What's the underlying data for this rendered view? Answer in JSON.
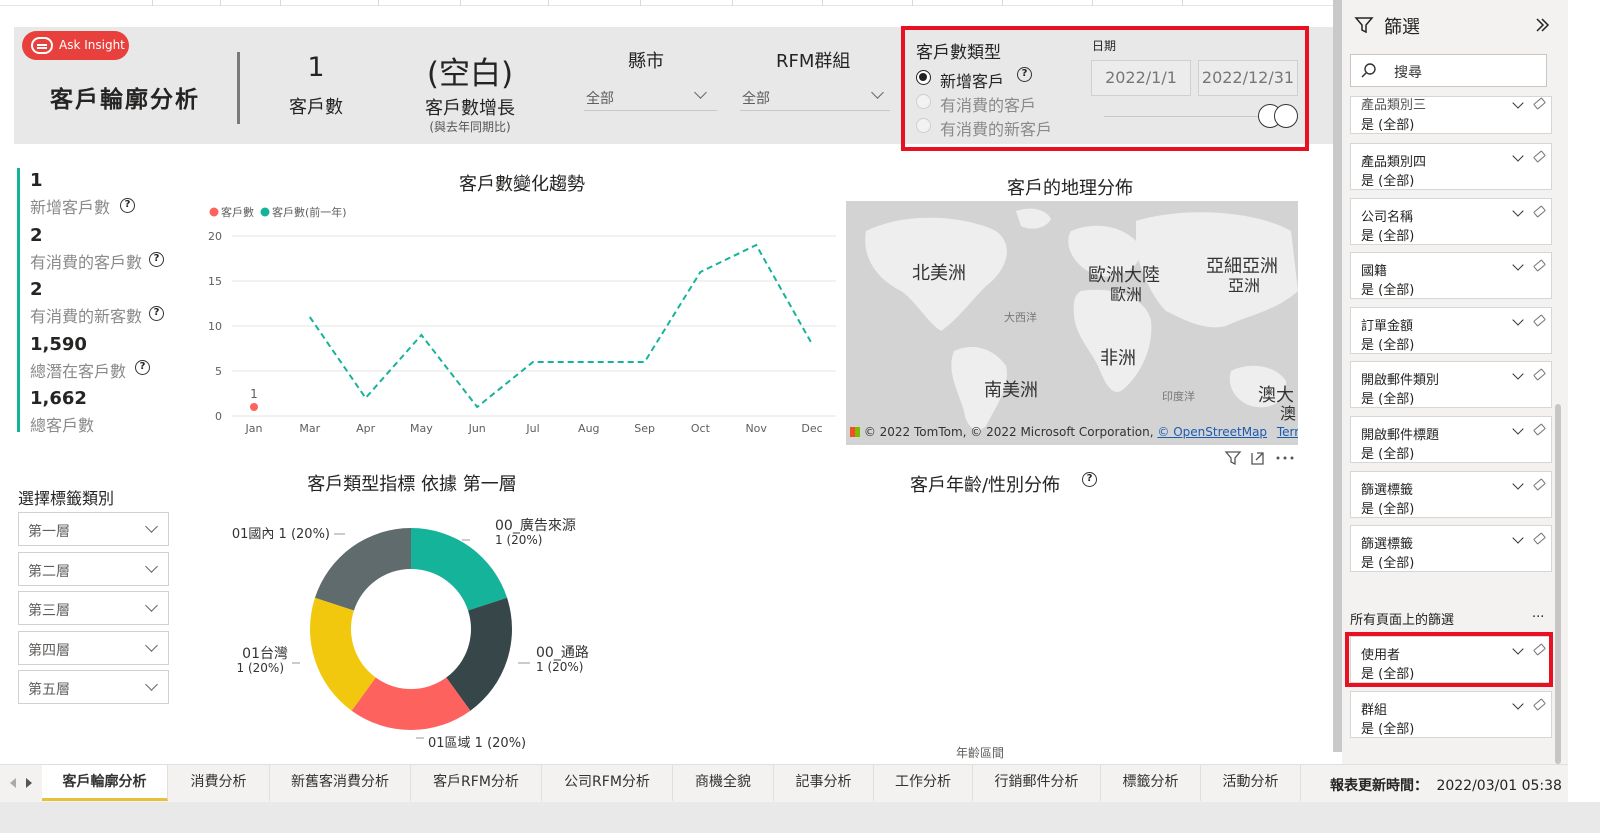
{
  "report": {
    "ask_insight_label": "Ask Insight",
    "title": "客戶輪廓分析"
  },
  "header_kpis": {
    "customer_count_value": "1",
    "customer_count_label": "客戶數",
    "growth_value": "(空白)",
    "growth_label": "客戶數增長",
    "growth_sublabel": "(與去年同期比)"
  },
  "slicers": {
    "county": {
      "title": "縣市",
      "value": "全部"
    },
    "rfm": {
      "title": "RFM群組",
      "value": "全部"
    }
  },
  "customer_type": {
    "title": "客戶數類型",
    "options": [
      {
        "label": "新增客戶",
        "selected": true
      },
      {
        "label": "有消費的客戶",
        "selected": false
      },
      {
        "label": "有消費的新客戶",
        "selected": false
      }
    ],
    "help_icon": "question-circle-icon"
  },
  "date_slicer": {
    "title": "日期",
    "start": "2022/1/1",
    "end": "2022/12/31"
  },
  "kpi_cards": [
    {
      "value": "1",
      "label": "新增客戶數"
    },
    {
      "value": "2",
      "label": "有消費的客戶數"
    },
    {
      "value": "2",
      "label": "有消費的新客數"
    },
    {
      "value": "1,590",
      "label": "總潛在客戶數"
    },
    {
      "value": "1,662",
      "label": "總客戶數"
    }
  ],
  "trend_title": "客戶數變化趨勢",
  "map": {
    "title": "客戶的地理分佈",
    "labels": {
      "north_america": "北美洲",
      "europe_big": "歐洲大陸",
      "europe": "歐洲",
      "asia": "亞細亞洲",
      "asia_small": "亞洲",
      "atlantic": "大西洋",
      "africa": "非洲",
      "south_america": "南美洲",
      "indian_ocean": "印度洋",
      "australia_1": "澳大",
      "australia_2": "澳"
    },
    "credit_prefix": "© 2022 TomTom, © 2022 Microsoft Corporation, ",
    "credit_osm": "© OpenStreetMap",
    "credit_terms": "Terms"
  },
  "tag_selector": {
    "title": "選擇標籤類別",
    "levels": [
      "第一層",
      "第二層",
      "第三層",
      "第四層",
      "第五層"
    ]
  },
  "donut_title": "客戶類型指標 依據 第一層",
  "age_gender": {
    "title": "客戶年齡/性別分佈",
    "axis_label": "年齡區間"
  },
  "filter_pane": {
    "title": "篩選",
    "search_placeholder": "搜尋",
    "cards": [
      {
        "title": "產品類別三",
        "value": "是 (全部)"
      },
      {
        "title": "產品類別四",
        "value": "是 (全部)"
      },
      {
        "title": "公司名稱",
        "value": "是 (全部)"
      },
      {
        "title": "國籍",
        "value": "是 (全部)"
      },
      {
        "title": "訂單金額",
        "value": "是 (全部)"
      },
      {
        "title": "開啟郵件類別",
        "value": "是 (全部)"
      },
      {
        "title": "開啟郵件標題",
        "value": "是 (全部)"
      },
      {
        "title": "篩選標籤",
        "value": "是 (全部)"
      },
      {
        "title": "篩選標籤",
        "value": "是 (全部)"
      }
    ],
    "all_pages_label": "所有頁面上的篩選",
    "all_pages_more": "...",
    "all_pages_cards": [
      {
        "title": "使用者",
        "value": "是 (全部)"
      },
      {
        "title": "群組",
        "value": "是 (全部)"
      }
    ]
  },
  "tabs": {
    "items": [
      "客戶輪廓分析",
      "消費分析",
      "新舊客消費分析",
      "客戶RFM分析",
      "公司RFM分析",
      "商機全貌",
      "記事分析",
      "工作分析",
      "行銷郵件分析",
      "標籤分析",
      "活動分析"
    ],
    "active_index": 0,
    "update_label": "報表更新時間：",
    "update_value": "2022/03/01 05:38"
  },
  "colors": {
    "accent_red": "#e81123",
    "teal": "#15b39a",
    "coral": "#fd625e",
    "dark": "#374649",
    "slate": "#5f6b6d",
    "yellow": "#f2c80f"
  },
  "chart_data": [
    {
      "type": "line",
      "title": "客戶數變化趨勢",
      "categories": [
        "Jan",
        "Mar",
        "Apr",
        "May",
        "Jun",
        "Jul",
        "Aug",
        "Sep",
        "Oct",
        "Nov",
        "Dec"
      ],
      "series": [
        {
          "name": "客戶數",
          "values": [
            1,
            null,
            null,
            null,
            null,
            null,
            null,
            null,
            null,
            null,
            null
          ]
        },
        {
          "name": "客戶數(前一年)",
          "values": [
            null,
            11,
            2,
            9,
            1,
            6,
            6,
            6,
            16,
            19,
            8
          ]
        }
      ],
      "data_labels": [
        "1"
      ],
      "ylim": [
        0,
        20
      ],
      "yticks": [
        0,
        5,
        10,
        15,
        20
      ],
      "grid": true,
      "legend": "top-left"
    },
    {
      "type": "pie",
      "title": "客戶類型指標 依據 第一層",
      "slices": [
        {
          "label": "00_廣告來源",
          "value": 1,
          "pct": "1 (20%)",
          "color": "#15b39a"
        },
        {
          "label": "00_通路",
          "value": 1,
          "pct": "1 (20%)",
          "color": "#374649"
        },
        {
          "label": "01區域",
          "value": 1,
          "pct": "1 (20%)",
          "color": "#fd625e"
        },
        {
          "label": "01台灣",
          "value": 1,
          "pct": "1 (20%)",
          "color": "#f2c80f"
        },
        {
          "label": "01國內",
          "value": 1,
          "pct": "1 (20%)",
          "color": "#5f6b6d"
        }
      ]
    }
  ]
}
